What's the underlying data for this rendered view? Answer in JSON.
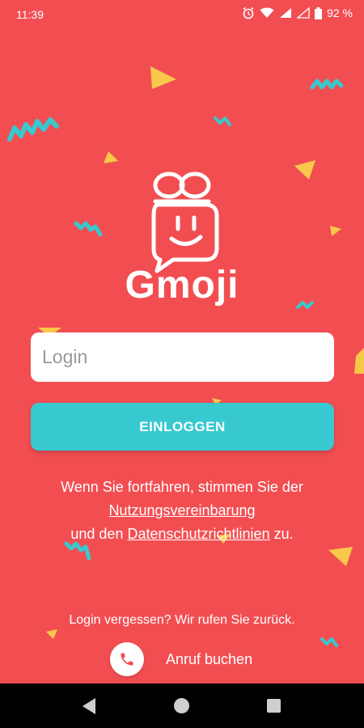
{
  "status_bar": {
    "time": "11:39",
    "battery": "92 %"
  },
  "app": {
    "name": "Gmoji"
  },
  "login_field": {
    "placeholder": "Login",
    "value": ""
  },
  "login_button": {
    "label": "EINLOGGEN"
  },
  "terms": {
    "line1": "Wenn Sie fortfahren, stimmen Sie der",
    "agreement_link": "Nutzungsvereinbarung",
    "line3_prefix": "und den",
    "privacy_link": "Datenschutzrichtlinien",
    "line3_suffix": "zu."
  },
  "forgot": {
    "text": "Login vergessen? Wir rufen Sie zurück."
  },
  "call": {
    "label": "Anruf buchen"
  },
  "colors": {
    "background": "#f24e52",
    "accent_teal": "#37c9cf",
    "accent_yellow": "#f7c84a"
  }
}
